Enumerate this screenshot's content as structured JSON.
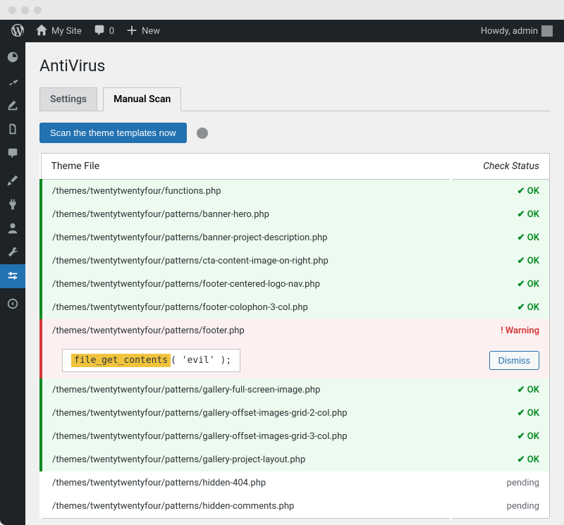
{
  "adminbar": {
    "site_name": "My Site",
    "comments_count": "0",
    "new_label": "New",
    "howdy": "Howdy, admin"
  },
  "page": {
    "title": "AntiVirus",
    "tabs": [
      {
        "label": "Settings",
        "active": false
      },
      {
        "label": "Manual Scan",
        "active": true
      }
    ],
    "scan_button": "Scan the theme templates now",
    "table": {
      "col_file": "Theme File",
      "col_status": "Check Status",
      "ok_text": "✔ OK",
      "warning_text": "! Warning",
      "pending_text": "pending",
      "dismiss_label": "Dismiss",
      "warning_code": {
        "highlight": "file_get_contents",
        "rest": "( 'evil' );"
      },
      "rows": [
        {
          "file": "/themes/twentytwentyfour/functions.php",
          "status": "ok"
        },
        {
          "file": "/themes/twentytwentyfour/patterns/banner-hero.php",
          "status": "ok"
        },
        {
          "file": "/themes/twentytwentyfour/patterns/banner-project-description.php",
          "status": "ok"
        },
        {
          "file": "/themes/twentytwentyfour/patterns/cta-content-image-on-right.php",
          "status": "ok"
        },
        {
          "file": "/themes/twentytwentyfour/patterns/footer-centered-logo-nav.php",
          "status": "ok"
        },
        {
          "file": "/themes/twentytwentyfour/patterns/footer-colophon-3-col.php",
          "status": "ok"
        },
        {
          "file": "/themes/twentytwentyfour/patterns/footer.php",
          "status": "warning"
        },
        {
          "file": "/themes/twentytwentyfour/patterns/gallery-full-screen-image.php",
          "status": "ok"
        },
        {
          "file": "/themes/twentytwentyfour/patterns/gallery-offset-images-grid-2-col.php",
          "status": "ok"
        },
        {
          "file": "/themes/twentytwentyfour/patterns/gallery-offset-images-grid-3-col.php",
          "status": "ok"
        },
        {
          "file": "/themes/twentytwentyfour/patterns/gallery-project-layout.php",
          "status": "ok"
        },
        {
          "file": "/themes/twentytwentyfour/patterns/hidden-404.php",
          "status": "pending"
        },
        {
          "file": "/themes/twentytwentyfour/patterns/hidden-comments.php",
          "status": "pending"
        }
      ]
    }
  },
  "sidebar_icons": [
    "dashboard",
    "pin",
    "media",
    "pages",
    "comments",
    "sep",
    "appearance",
    "plugins",
    "users",
    "tools",
    "settings-antivirus",
    "sep",
    "collapse"
  ]
}
